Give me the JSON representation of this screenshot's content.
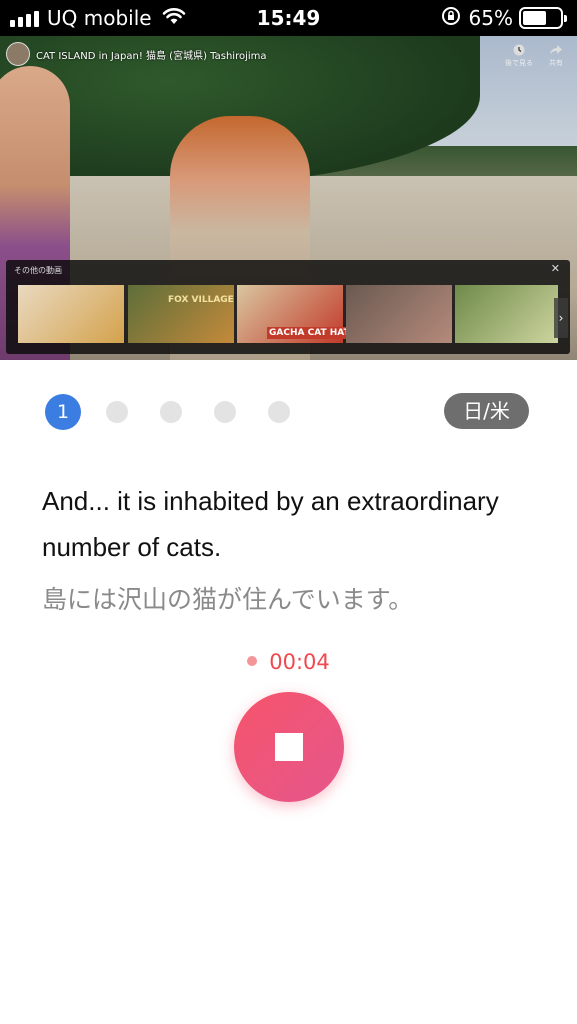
{
  "status_bar": {
    "carrier": "UQ mobile",
    "time": "15:49",
    "battery_percent": "65%",
    "battery_level": 0.65,
    "icons": [
      "signal-icon",
      "wifi-icon",
      "rotation-lock-icon",
      "battery-icon"
    ]
  },
  "video": {
    "title": "CAT ISLAND in Japan!   猫島 (宮城県) Tashirojima",
    "actions": [
      {
        "icon": "clock-icon",
        "label": "後で見る"
      },
      {
        "icon": "share-icon",
        "label": "共有"
      }
    ],
    "more_videos": {
      "title": "その他の動画",
      "close_icon": "close-icon",
      "thumbnails": [
        {
          "label": "",
          "colors": [
            "#e9d9c0",
            "#d4a24c"
          ]
        },
        {
          "label": "FOX VILLAGE",
          "colors": [
            "#5d6e3a",
            "#c48a3a"
          ]
        },
        {
          "label": "GACHA CAT HATS",
          "colors": [
            "#d9c6a0",
            "#c23a2a"
          ]
        },
        {
          "label": "",
          "colors": [
            "#6a5a52",
            "#b58a7a"
          ]
        },
        {
          "label": "",
          "colors": [
            "#6f8a4a",
            "#cfd6a0"
          ]
        }
      ]
    }
  },
  "progress": {
    "current": "1",
    "total_dots": 5
  },
  "lang_toggle": "日/米",
  "sentence": {
    "english": "And... it is inhabited by an extraordinary number of cats.",
    "japanese": "島には沢山の猫が住んでいます。"
  },
  "recording": {
    "elapsed": "00:04"
  },
  "colors": {
    "accent_blue": "#3b7de0",
    "record_red": "#f1484f",
    "button_gradient_start": "#f6546a",
    "button_gradient_end": "#e5578d"
  }
}
